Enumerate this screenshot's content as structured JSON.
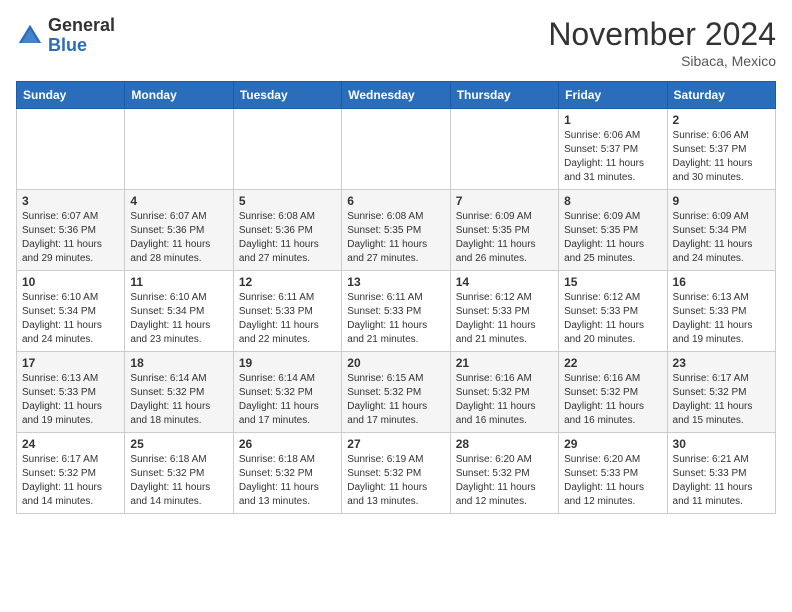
{
  "header": {
    "logo_general": "General",
    "logo_blue": "Blue",
    "month_title": "November 2024",
    "location": "Sibaca, Mexico"
  },
  "weekdays": [
    "Sunday",
    "Monday",
    "Tuesday",
    "Wednesday",
    "Thursday",
    "Friday",
    "Saturday"
  ],
  "weeks": [
    [
      {
        "day": "",
        "info": ""
      },
      {
        "day": "",
        "info": ""
      },
      {
        "day": "",
        "info": ""
      },
      {
        "day": "",
        "info": ""
      },
      {
        "day": "",
        "info": ""
      },
      {
        "day": "1",
        "info": "Sunrise: 6:06 AM\nSunset: 5:37 PM\nDaylight: 11 hours\nand 31 minutes."
      },
      {
        "day": "2",
        "info": "Sunrise: 6:06 AM\nSunset: 5:37 PM\nDaylight: 11 hours\nand 30 minutes."
      }
    ],
    [
      {
        "day": "3",
        "info": "Sunrise: 6:07 AM\nSunset: 5:36 PM\nDaylight: 11 hours\nand 29 minutes."
      },
      {
        "day": "4",
        "info": "Sunrise: 6:07 AM\nSunset: 5:36 PM\nDaylight: 11 hours\nand 28 minutes."
      },
      {
        "day": "5",
        "info": "Sunrise: 6:08 AM\nSunset: 5:36 PM\nDaylight: 11 hours\nand 27 minutes."
      },
      {
        "day": "6",
        "info": "Sunrise: 6:08 AM\nSunset: 5:35 PM\nDaylight: 11 hours\nand 27 minutes."
      },
      {
        "day": "7",
        "info": "Sunrise: 6:09 AM\nSunset: 5:35 PM\nDaylight: 11 hours\nand 26 minutes."
      },
      {
        "day": "8",
        "info": "Sunrise: 6:09 AM\nSunset: 5:35 PM\nDaylight: 11 hours\nand 25 minutes."
      },
      {
        "day": "9",
        "info": "Sunrise: 6:09 AM\nSunset: 5:34 PM\nDaylight: 11 hours\nand 24 minutes."
      }
    ],
    [
      {
        "day": "10",
        "info": "Sunrise: 6:10 AM\nSunset: 5:34 PM\nDaylight: 11 hours\nand 24 minutes."
      },
      {
        "day": "11",
        "info": "Sunrise: 6:10 AM\nSunset: 5:34 PM\nDaylight: 11 hours\nand 23 minutes."
      },
      {
        "day": "12",
        "info": "Sunrise: 6:11 AM\nSunset: 5:33 PM\nDaylight: 11 hours\nand 22 minutes."
      },
      {
        "day": "13",
        "info": "Sunrise: 6:11 AM\nSunset: 5:33 PM\nDaylight: 11 hours\nand 21 minutes."
      },
      {
        "day": "14",
        "info": "Sunrise: 6:12 AM\nSunset: 5:33 PM\nDaylight: 11 hours\nand 21 minutes."
      },
      {
        "day": "15",
        "info": "Sunrise: 6:12 AM\nSunset: 5:33 PM\nDaylight: 11 hours\nand 20 minutes."
      },
      {
        "day": "16",
        "info": "Sunrise: 6:13 AM\nSunset: 5:33 PM\nDaylight: 11 hours\nand 19 minutes."
      }
    ],
    [
      {
        "day": "17",
        "info": "Sunrise: 6:13 AM\nSunset: 5:33 PM\nDaylight: 11 hours\nand 19 minutes."
      },
      {
        "day": "18",
        "info": "Sunrise: 6:14 AM\nSunset: 5:32 PM\nDaylight: 11 hours\nand 18 minutes."
      },
      {
        "day": "19",
        "info": "Sunrise: 6:14 AM\nSunset: 5:32 PM\nDaylight: 11 hours\nand 17 minutes."
      },
      {
        "day": "20",
        "info": "Sunrise: 6:15 AM\nSunset: 5:32 PM\nDaylight: 11 hours\nand 17 minutes."
      },
      {
        "day": "21",
        "info": "Sunrise: 6:16 AM\nSunset: 5:32 PM\nDaylight: 11 hours\nand 16 minutes."
      },
      {
        "day": "22",
        "info": "Sunrise: 6:16 AM\nSunset: 5:32 PM\nDaylight: 11 hours\nand 16 minutes."
      },
      {
        "day": "23",
        "info": "Sunrise: 6:17 AM\nSunset: 5:32 PM\nDaylight: 11 hours\nand 15 minutes."
      }
    ],
    [
      {
        "day": "24",
        "info": "Sunrise: 6:17 AM\nSunset: 5:32 PM\nDaylight: 11 hours\nand 14 minutes."
      },
      {
        "day": "25",
        "info": "Sunrise: 6:18 AM\nSunset: 5:32 PM\nDaylight: 11 hours\nand 14 minutes."
      },
      {
        "day": "26",
        "info": "Sunrise: 6:18 AM\nSunset: 5:32 PM\nDaylight: 11 hours\nand 13 minutes."
      },
      {
        "day": "27",
        "info": "Sunrise: 6:19 AM\nSunset: 5:32 PM\nDaylight: 11 hours\nand 13 minutes."
      },
      {
        "day": "28",
        "info": "Sunrise: 6:20 AM\nSunset: 5:32 PM\nDaylight: 11 hours\nand 12 minutes."
      },
      {
        "day": "29",
        "info": "Sunrise: 6:20 AM\nSunset: 5:33 PM\nDaylight: 11 hours\nand 12 minutes."
      },
      {
        "day": "30",
        "info": "Sunrise: 6:21 AM\nSunset: 5:33 PM\nDaylight: 11 hours\nand 11 minutes."
      }
    ]
  ]
}
